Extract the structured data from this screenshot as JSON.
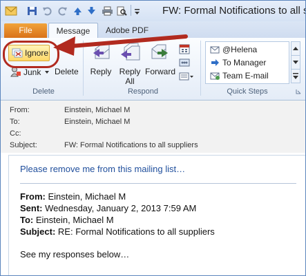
{
  "window": {
    "title": "FW: Formal Notifications to all suppliers"
  },
  "tabs": [
    {
      "label": "File"
    },
    {
      "label": "Message"
    },
    {
      "label": "Adobe PDF"
    }
  ],
  "ribbon": {
    "delete_group": {
      "label": "Delete",
      "ignore_label": "Ignore",
      "junk_label": "Junk",
      "delete_label": "Delete"
    },
    "respond_group": {
      "label": "Respond",
      "reply_label": "Reply",
      "reply_all_line1": "Reply",
      "reply_all_line2": "All",
      "forward_label": "Forward"
    },
    "quick_steps_group": {
      "label": "Quick Steps",
      "items": [
        {
          "label": "@Helena"
        },
        {
          "label": "To Manager"
        },
        {
          "label": "Team E-mail"
        }
      ]
    }
  },
  "header_fields": {
    "from_label": "From:",
    "from_value": "Einstein, Michael M",
    "to_label": "To:",
    "to_value": "Einstein, Michael M",
    "cc_label": "Cc:",
    "cc_value": "",
    "subject_label": "Subject:",
    "subject_value": "FW: Formal Notifications to all suppliers"
  },
  "body": {
    "reply_text": "Please remove me from this mailing list…",
    "quoted": {
      "from_label": "From:",
      "from_value": "Einstein, Michael M",
      "sent_label": "Sent:",
      "sent_value": "Wednesday, January 2, 2013 7:59 AM",
      "to_label": "To:",
      "to_value": "Einstein, Michael M",
      "subject_label": "Subject:",
      "subject_value": "RE: Formal Notifications to all suppliers"
    },
    "closing_text": "See my responses below…"
  },
  "colors": {
    "accent": "#b12a1f",
    "file_tab": "#e0811f",
    "link_blue": "#1f4e9c"
  }
}
